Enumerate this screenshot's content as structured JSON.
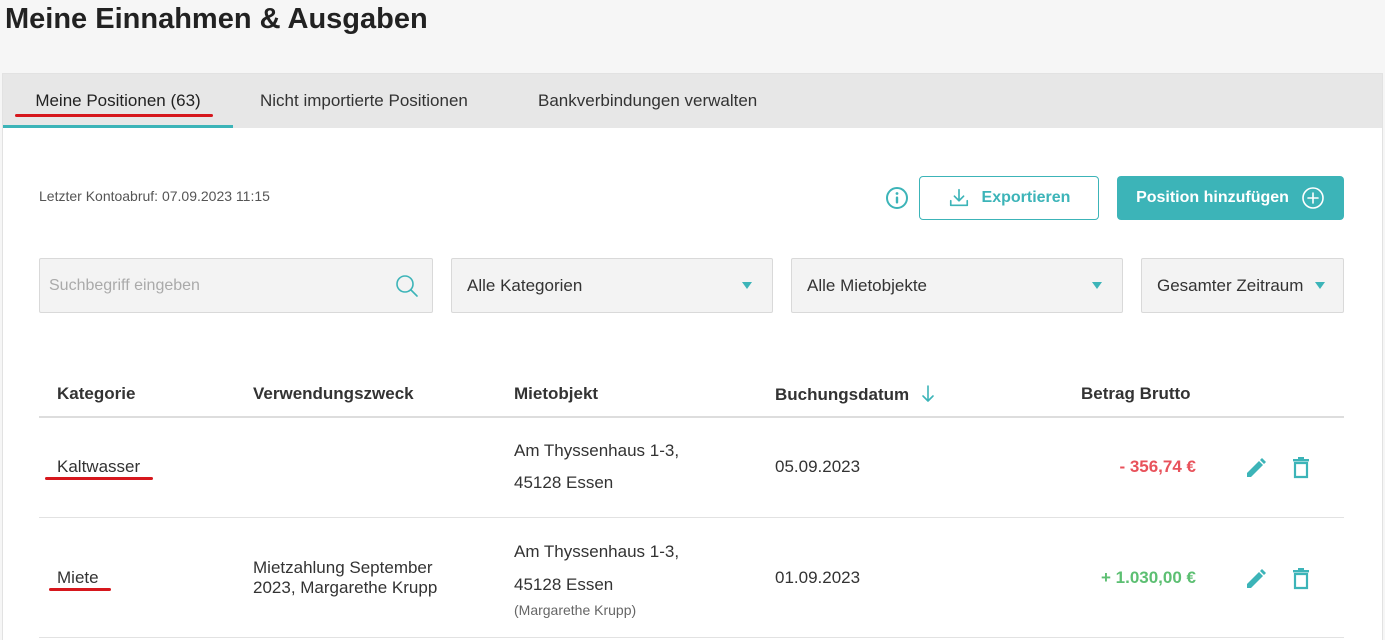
{
  "page": {
    "title": "Meine Einnahmen & Ausgaben"
  },
  "tabs": [
    {
      "label": "Meine Positionen (63)",
      "active": true
    },
    {
      "label": "Nicht importierte Positionen",
      "active": false
    },
    {
      "label": "Bankverbindungen verwalten",
      "active": false
    }
  ],
  "toolbar": {
    "last_fetch": "Letzter Kontoabruf: 07.09.2023 11:15",
    "export_label": "Exportieren",
    "add_label": "Position hinzufügen"
  },
  "filters": {
    "search_placeholder": "Suchbegriff eingeben",
    "category": "Alle Kategorien",
    "property": "Alle Mietobjekte",
    "period": "Gesamter Zeitraum"
  },
  "table": {
    "columns": [
      "Kategorie",
      "Verwendungszweck",
      "Mietobjekt",
      "Buchungsdatum",
      "Betrag Brutto"
    ],
    "sorted_column": "Buchungsdatum",
    "rows": [
      {
        "category": "Kaltwasser",
        "purpose_line1": "",
        "purpose_line2": "",
        "property_line1": "Am Thyssenhaus 1-3,",
        "property_line2": "45128 Essen",
        "property_note": "",
        "date": "05.09.2023",
        "amount": "- 356,74 €",
        "amount_type": "negative"
      },
      {
        "category": "Miete",
        "purpose_line1": "Mietzahlung September",
        "purpose_line2": "2023, Margarethe Krupp",
        "property_line1": "Am Thyssenhaus 1-3,",
        "property_line2": "45128 Essen",
        "property_note": "(Margarethe Krupp)",
        "date": "01.09.2023",
        "amount": "+ 1.030,00 €",
        "amount_type": "positive"
      }
    ]
  },
  "colors": {
    "accent": "#3cb4b8",
    "negative": "#e8525b",
    "positive": "#5cbf72",
    "annotation": "#d6171d"
  },
  "icons": {
    "info": "info-icon",
    "export": "download-icon",
    "add": "plus-circle-icon",
    "search": "search-icon",
    "edit": "pencil-icon",
    "delete": "trash-icon",
    "sort": "arrow-down-icon"
  }
}
